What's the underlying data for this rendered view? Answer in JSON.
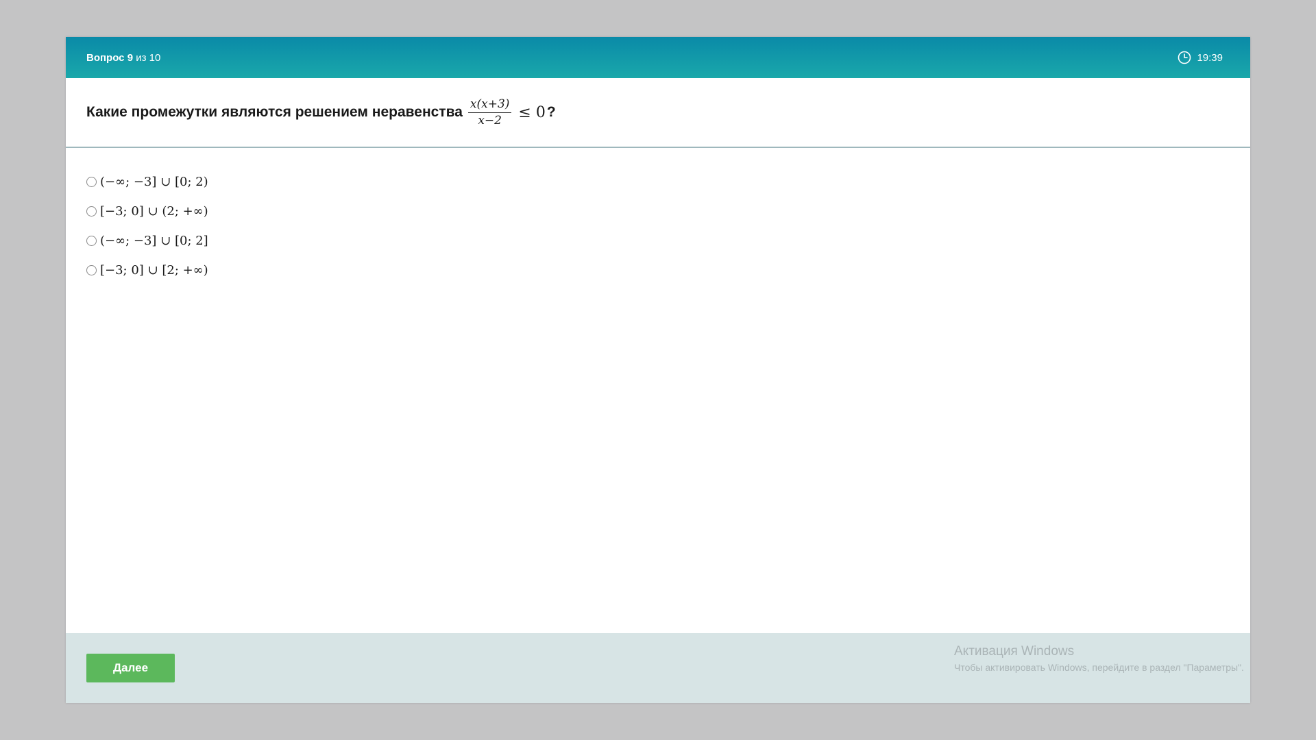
{
  "header": {
    "question_word": "Вопрос 9",
    "question_of": "из 10",
    "timer": "19:39"
  },
  "question": {
    "text": "Какие промежутки являются решением неравенства",
    "numerator": "x(x+3)",
    "denominator": "x−2",
    "rhs": "≤ 0",
    "suffix": "?"
  },
  "options": [
    {
      "label": "(−∞; −3] ∪ [0; 2)"
    },
    {
      "label": "[−3; 0] ∪ (2; +∞)"
    },
    {
      "label": "(−∞; −3] ∪ [0; 2]"
    },
    {
      "label": "[−3; 0] ∪ [2; +∞)"
    }
  ],
  "footer": {
    "next_label": "Далее"
  },
  "watermark": {
    "title": "Активация Windows",
    "subtitle": "Чтобы активировать Windows, перейдите в раздел \"Параметры\"."
  },
  "colors": {
    "header_top": "#0a8aa8",
    "header_bottom": "#1aa8aa",
    "next_button": "#5cb85c",
    "footer_bg": "#d7e4e5"
  }
}
